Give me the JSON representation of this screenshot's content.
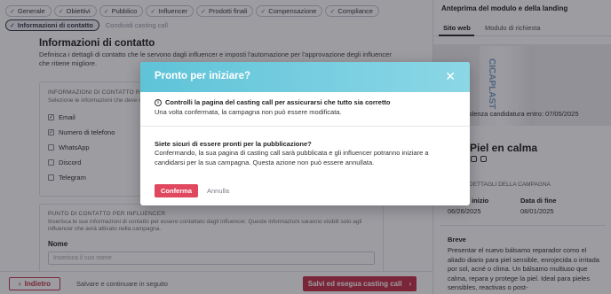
{
  "tabs_row1": [
    {
      "label": "Generale",
      "checked": true
    },
    {
      "label": "Obiettivi",
      "checked": true
    },
    {
      "label": "Pubblico",
      "checked": true
    },
    {
      "label": "Influencer",
      "checked": true
    },
    {
      "label": "Prodotti finali",
      "checked": true
    },
    {
      "label": "Compensazione",
      "checked": true
    },
    {
      "label": "Compliance",
      "checked": true
    }
  ],
  "tabs_row2": [
    {
      "label": "Informazioni di contatto",
      "checked": true,
      "active": true
    },
    {
      "label": "Condividi casting call",
      "checked": false,
      "disabled": true
    }
  ],
  "section": {
    "title": "Informazioni di contatto",
    "description": "Definisca i dettagli di contatto che le servono dagli influencer e imposti l'automazione per l'approvazione degli influencer che ritiene migliore."
  },
  "contact_card": {
    "heading": "INFORMAZIONI DI CONTATTO RICH",
    "sub": "Selezione le informazioni che deve in",
    "options": [
      {
        "label": "Email",
        "checked": true
      },
      {
        "label": "Numero di telefono",
        "checked": true
      },
      {
        "label": "WhatsApp",
        "checked": false
      },
      {
        "label": "Discord",
        "checked": false
      },
      {
        "label": "Telegram",
        "checked": false
      }
    ]
  },
  "point_card": {
    "heading": "PUNTO DI CONTATTO PER INFLUENCER",
    "sub": "Inserisca le sue informazioni di contatto per essere contattato dagli influencer. Queste informazioni saranno visibili solo agli influencer che avrà attivato nella campagna.",
    "name_label": "Nome",
    "name_placeholder": "Inserisca il suo nome"
  },
  "footer": {
    "back": "Indietro",
    "save_later": "Salvare e continuare in seguito",
    "save_run": "Salvi ed esegua casting call"
  },
  "preview": {
    "title": "Anteprima del modulo e della landing",
    "tabs": [
      "Sito web",
      "Modulo di richiesta"
    ],
    "deadline": "Scadenza candidatura entro: 07/05/2025",
    "product_name": "Piel en calma",
    "details_heading": "DETTAGLI DELLA CAMPAGNA",
    "start_label": "Data di inizio",
    "start_value": "06/26/2025",
    "end_label": "Data di fine",
    "end_value": "08/01/2025",
    "brief_label": "Breve",
    "brief_text": "Presentar el nuevo bálsamo reparador como el aliado diario para piel sensible, enrojecida o irritada por sol, acné o clima. Un bálsamo multiuso que calma, repara y protege la piel. Ideal para pieles sensibles, reactivas o post-"
  },
  "modal": {
    "title": "Pronto per iniziare?",
    "notice_title": "Controlli la pagina del casting call per assicurarsi che tutto sia corretto",
    "notice_text": "Una volta confermata, la campagna non può essere modificata.",
    "question": "Siete sicuri di essere pronti per la pubblicazione?",
    "text": "Confermando, la sua pagina di casting call sarà pubblicata e gli influencer potranno iniziare a candidarsi per la sua campagna. Questa azione non può essere annullata.",
    "confirm": "Conferma",
    "cancel": "Annulla"
  },
  "colors": {
    "accent": "#c6334b",
    "modal_header": "#6fcbdd",
    "confirm": "#e0485f"
  }
}
